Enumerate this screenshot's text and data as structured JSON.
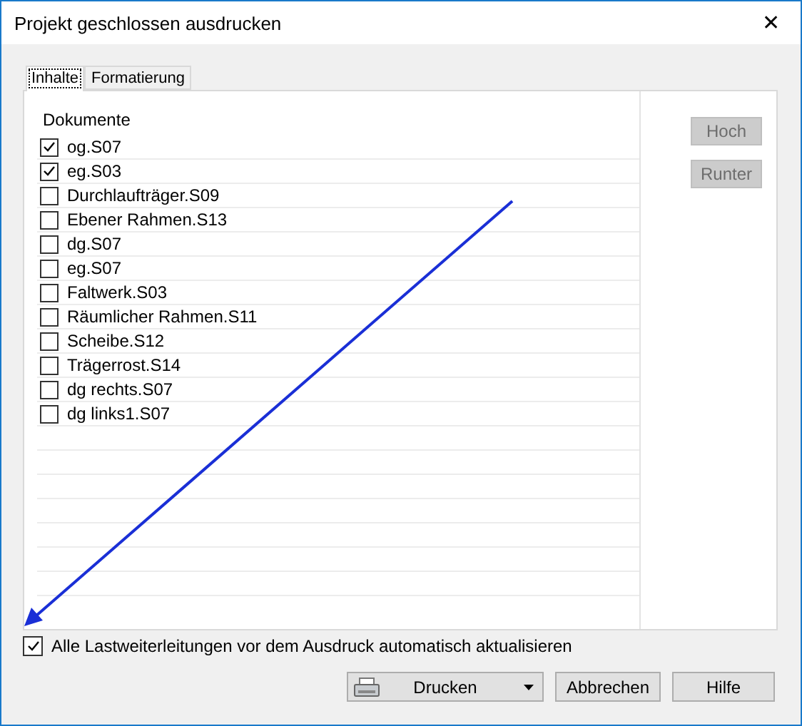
{
  "window": {
    "title": "Projekt geschlossen ausdrucken",
    "close": "✕"
  },
  "tabs": [
    {
      "label": "Inhalte",
      "selected": true
    },
    {
      "label": "Formatierung",
      "selected": false
    }
  ],
  "documents": {
    "header": "Dokumente",
    "items": [
      {
        "name": "og.S07",
        "checked": true
      },
      {
        "name": "eg.S03",
        "checked": true
      },
      {
        "name": "Durchlaufträger.S09",
        "checked": false
      },
      {
        "name": "Ebener Rahmen.S13",
        "checked": false
      },
      {
        "name": "dg.S07",
        "checked": false
      },
      {
        "name": "eg.S07",
        "checked": false
      },
      {
        "name": "Faltwerk.S03",
        "checked": false
      },
      {
        "name": "Räumlicher Rahmen.S11",
        "checked": false
      },
      {
        "name": "Scheibe.S12",
        "checked": false
      },
      {
        "name": "Trägerrost.S14",
        "checked": false
      },
      {
        "name": "dg rechts.S07",
        "checked": false
      },
      {
        "name": "dg links1.S07",
        "checked": false
      }
    ]
  },
  "side_buttons": [
    {
      "label": "Hoch",
      "disabled": true
    },
    {
      "label": "Runter",
      "disabled": true
    }
  ],
  "option": {
    "label": "Alle Lastweiterleitungen vor dem Ausdruck automatisch aktualisieren",
    "checked": true
  },
  "buttons": [
    {
      "label": "Drucken",
      "kind": "split"
    },
    {
      "label": "Abbrechen",
      "kind": "plain"
    },
    {
      "label": "Hilfe",
      "kind": "plain"
    }
  ]
}
